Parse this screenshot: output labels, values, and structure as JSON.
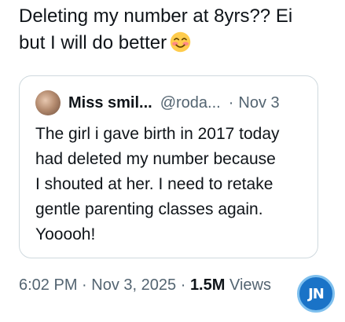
{
  "tweet": {
    "line1": "Deleting my number at 8yrs?? Ei",
    "line2": "but I will do better",
    "emoji_icon": "smiling-face-with-smiling-eyes"
  },
  "quote": {
    "name": "Miss smil...",
    "handle": "@roda...",
    "separator": "·",
    "date": "Nov 3",
    "body_lines": [
      "The girl i gave birth in 2017 today",
      "had deleted my number because",
      "I shouted at her. I need to retake",
      "gentle parenting classes again.",
      "Yooooh!"
    ]
  },
  "meta": {
    "time": "6:02 PM",
    "sep1": "·",
    "date": "Nov 3, 2025",
    "sep2": "·",
    "views_count": "1.5M",
    "views_label": "Views"
  },
  "watermark": {
    "text": "JN"
  }
}
